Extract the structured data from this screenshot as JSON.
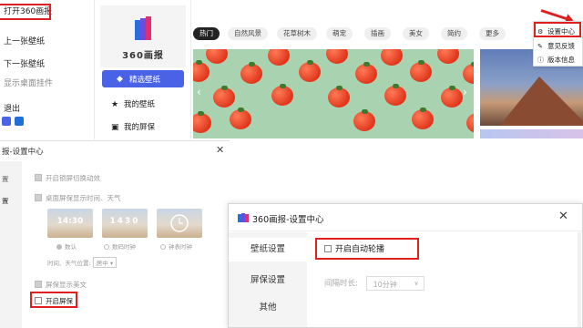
{
  "tray_menu": {
    "items": [
      "打开360画报",
      "上一张壁纸",
      "下一张壁纸",
      "显示桌面挂件",
      "退出"
    ]
  },
  "app": {
    "logo_text": "360画报",
    "nav": [
      {
        "label": "精选壁纸",
        "icon": "diamond-icon",
        "active": true
      },
      {
        "label": "我的壁纸",
        "icon": "star-icon",
        "active": false
      },
      {
        "label": "我的屏保",
        "icon": "screensaver-icon",
        "active": false
      }
    ],
    "tags": [
      "热门",
      "自然风景",
      "花草树木",
      "萌宠",
      "插画",
      "美女",
      "简约",
      "更多"
    ],
    "active_tag": "热门"
  },
  "top_menu": {
    "items": [
      {
        "label": "设置中心",
        "icon": "gear-icon"
      },
      {
        "label": "意见反馈",
        "icon": "edit-icon"
      },
      {
        "label": "版本信息",
        "icon": "info-icon"
      }
    ]
  },
  "old_dialog": {
    "title": "报-设置中心",
    "side_items": [
      "置",
      "置"
    ],
    "options": [
      "开启锁屏切换动效",
      "桌面屏保显示时间、天气"
    ],
    "clocks": [
      {
        "time": "14:30",
        "label": "数认"
      },
      {
        "time": "1430",
        "label": "数码时钟"
      },
      {
        "time": "",
        "label": "钟表时钟"
      }
    ],
    "position_label": "时间、天气位置:",
    "position_value": "居中",
    "show_poem": "屏保显示美文",
    "enable_screensaver": "开启屏保"
  },
  "dialog": {
    "title": "360画报-设置中心",
    "side_items": [
      "壁纸设置",
      "屏保设置",
      "其他"
    ],
    "auto_rotate_label": "开启自动轮播",
    "interval_label": "间隔时长:",
    "interval_value": "10分钟"
  },
  "colors": {
    "accent_blue": "#4a63e6",
    "highlight_red": "#e02020"
  }
}
